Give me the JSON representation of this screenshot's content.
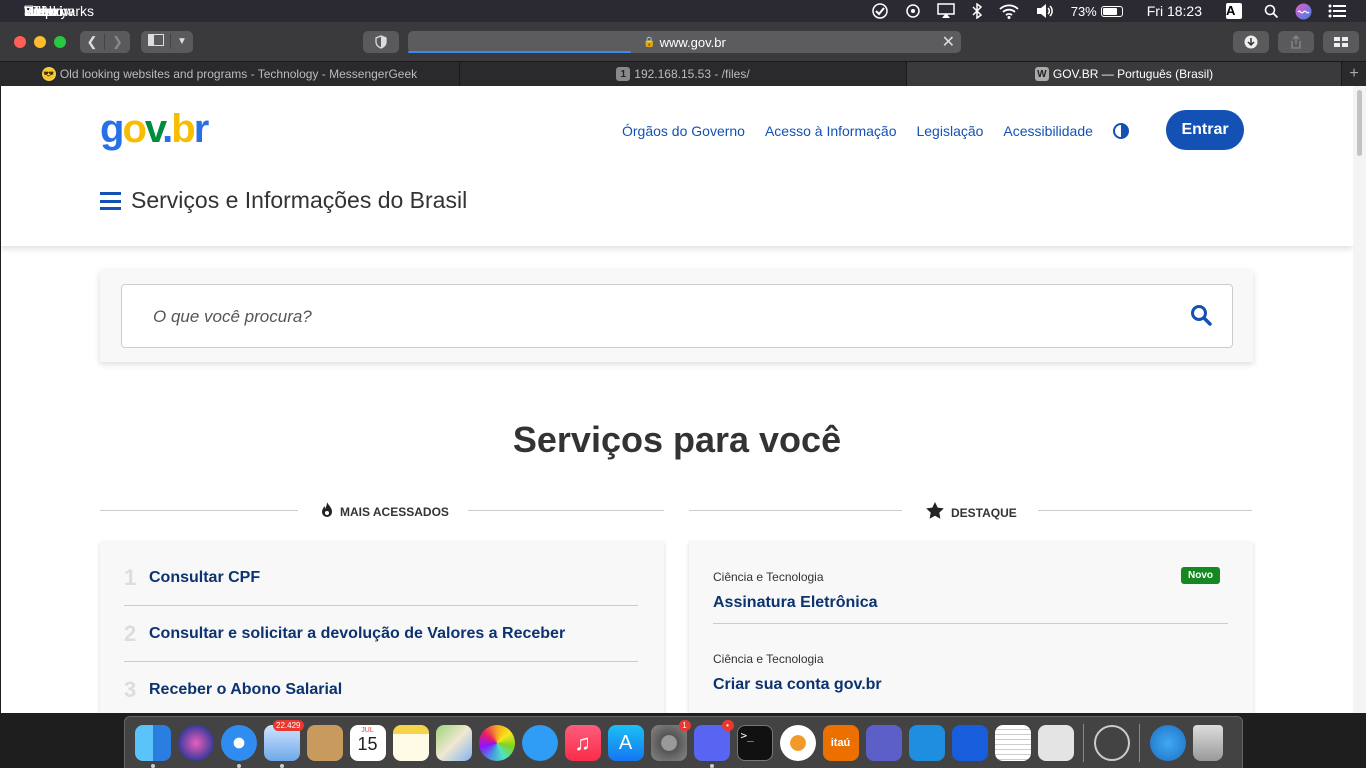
{
  "menubar": {
    "app": "Safari",
    "items": [
      "File",
      "Edit",
      "View",
      "History",
      "Bookmarks",
      "Window",
      "Help"
    ],
    "battery": "73%",
    "clock": "Fri 18:23",
    "input_source": "A"
  },
  "toolbar": {
    "url": "www.gov.br"
  },
  "tabs": [
    {
      "title": "Old looking websites and programs - Technology - MessengerGeek",
      "fav": "😎"
    },
    {
      "title": "192.168.15.53 - /files/",
      "fav": "1"
    },
    {
      "title": "GOV.BR — Português (Brasil)",
      "fav": "W"
    }
  ],
  "header": {
    "logo": {
      "g": "g",
      "o": "o",
      "v": "v",
      "d": ".",
      "b": "b",
      "r": "r"
    },
    "nav": [
      "Órgãos do Governo",
      "Acesso à Informação",
      "Legislação",
      "Acessibilidade"
    ],
    "login": "Entrar",
    "menu_title": "Serviços e Informações do Brasil"
  },
  "search": {
    "placeholder": "O que você procura?"
  },
  "main": {
    "title": "Serviços para você",
    "most_accessed": {
      "label": "MAIS ACESSADOS",
      "items": [
        {
          "n": "1",
          "title": "Consultar CPF"
        },
        {
          "n": "2",
          "title": "Consultar e solicitar a devolução de Valores a Receber"
        },
        {
          "n": "3",
          "title": "Receber o Abono Salarial"
        }
      ]
    },
    "featured": {
      "label": "DESTAQUE",
      "items": [
        {
          "category": "Ciência e Tecnologia",
          "title": "Assinatura Eletrônica",
          "badge": "Novo"
        },
        {
          "category": "Ciência e Tecnologia",
          "title": "Criar sua conta gov.br"
        }
      ]
    }
  },
  "dock": {
    "mail_badge": "22.429",
    "calendar_month": "JUL",
    "calendar_day": "15",
    "prefs_badge": "1",
    "discord_badge": "•",
    "itau_label": "itaú"
  }
}
